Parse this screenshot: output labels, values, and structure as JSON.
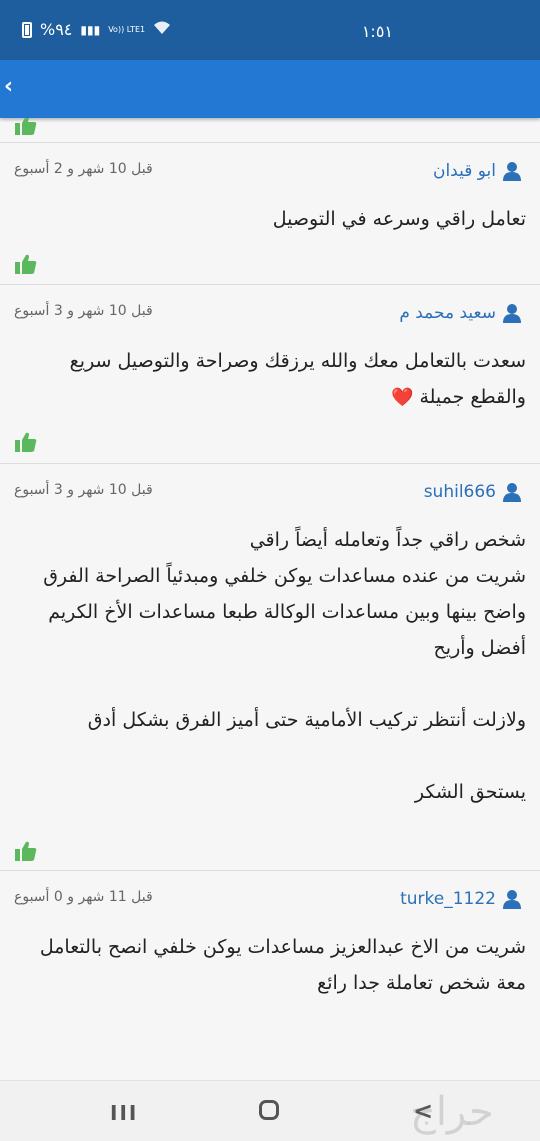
{
  "status_bar": {
    "battery_text": "%٩٤",
    "network": "Vo)) LTE1",
    "time": "١:٥١"
  },
  "app_bar": {
    "back_icon": "chevron-left-icon"
  },
  "colors": {
    "status_bar": "#1e5e9e",
    "app_bar": "#2278d3",
    "username": "#2c70b8",
    "thumb": "#5cb85c",
    "heart": "#e0202a"
  },
  "comments": [
    {
      "user": "ابو قيدان",
      "time": "قبل 10 شهر و 2 أسبوع",
      "text": "تعامل راقي وسرعه في التوصيل"
    },
    {
      "user": "سعيد محمد م",
      "time": "قبل 10 شهر و 3 أسبوع",
      "text": "سعدت بالتعامل معك والله يرزقك وصراحة والتوصيل سريع\nوالقطع جميلة",
      "emoji": "❤️"
    },
    {
      "user": "suhil666",
      "time": "قبل 10 شهر و 3 أسبوع",
      "text": "شخص راقي جداً وتعامله أيضاً راقي\nشريت من عنده مساعدات يوكن خلفي ومبدئياً الصراحة الفرق\nواضح بينها وبين مساعدات الوكالة طبعا مساعدات الأخ الكريم\nأفضل وأريح\n\nولازلت أنتظر تركيب الأمامية حتى أميز الفرق بشكل أدق\n\nيستحق الشكر"
    },
    {
      "user": "turke_1122",
      "time": "قبل 11 شهر و 0 أسبوع",
      "text": "شريت من الاخ عبدالعزيز مساعدات يوكن خلفي انصح بالتعامل\nمعة  شخص تعاملة جدا رائع"
    }
  ],
  "nav_bar": {
    "recent": "III",
    "back": "<",
    "watermark": "حراج"
  }
}
